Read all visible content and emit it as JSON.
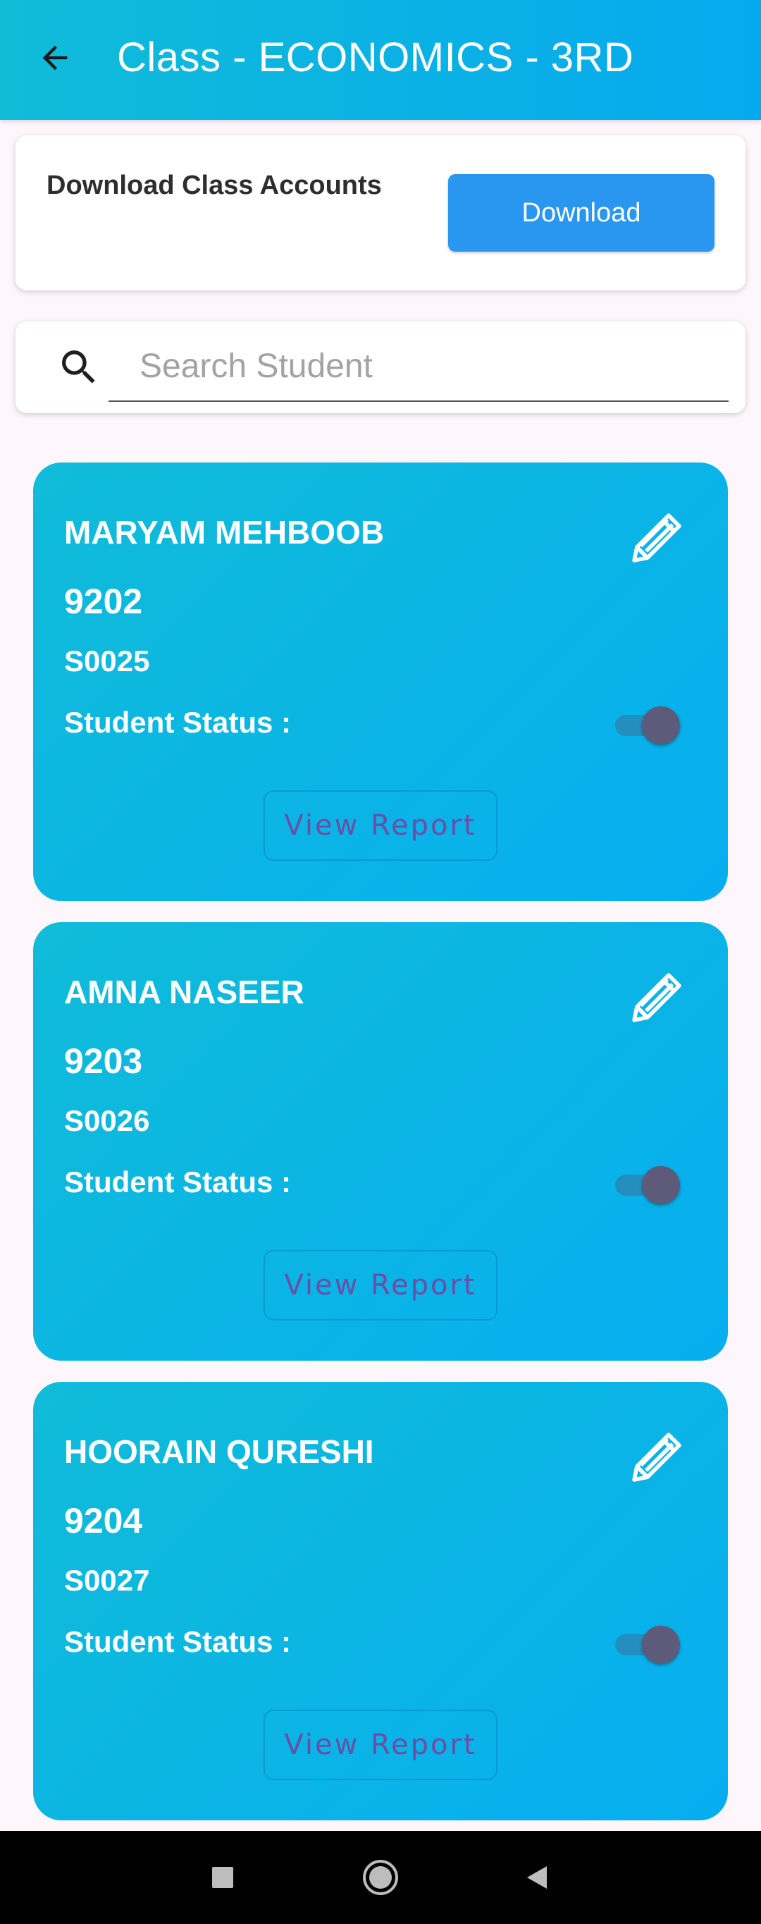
{
  "header": {
    "title": "Class - ECONOMICS - 3RD",
    "back_icon": "arrow-back-icon"
  },
  "download_card": {
    "label": "Download Class Accounts",
    "button_label": "Download"
  },
  "search": {
    "placeholder": "Search Student",
    "value": "",
    "icon": "search-icon"
  },
  "students": [
    {
      "name": "MARYAM MEHBOOB",
      "roll": "9202",
      "code": "S0025",
      "status_label": "Student Status :",
      "status_on": true,
      "report_label": "View Report"
    },
    {
      "name": "AMNA NASEER",
      "roll": "9203",
      "code": "S0026",
      "status_label": "Student Status :",
      "status_on": true,
      "report_label": "View Report"
    },
    {
      "name": "HOORAIN QURESHI",
      "roll": "9204",
      "code": "S0027",
      "status_label": "Student Status :",
      "status_on": true,
      "report_label": "View Report"
    }
  ],
  "colors": {
    "header_gradient": [
      "#10bcd8",
      "#06a9ee"
    ],
    "download_button": "#2996ef",
    "card_gradient": [
      "#10bcd8",
      "#06aef0"
    ],
    "toggle_thumb": "#5d5a7a",
    "report_text": "#6b4fa6"
  },
  "system_nav": {
    "buttons": [
      "recents-square-icon",
      "home-circle-icon",
      "back-triangle-icon"
    ]
  }
}
